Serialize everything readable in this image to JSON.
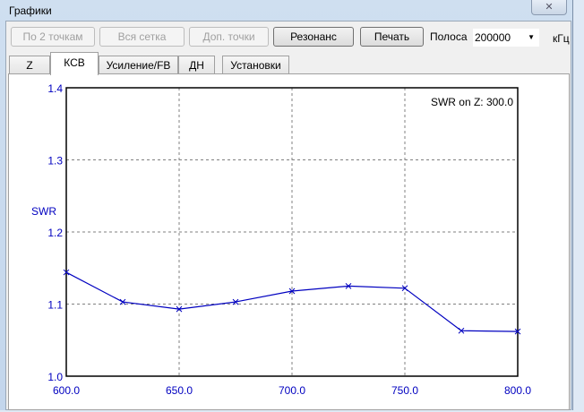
{
  "window": {
    "title": "Графики",
    "close_icon": "close-icon"
  },
  "toolbar": {
    "by_2_points": "По 2 точкам",
    "full_grid": "Вся сетка",
    "extra_points": "Доп. точки",
    "resonance": "Резонанс",
    "print": "Печать",
    "band_label": "Полоса",
    "band_value": "200000",
    "unit": "кГц"
  },
  "tabs": [
    {
      "label": "Z"
    },
    {
      "label": "КСВ"
    },
    {
      "label": "Усиление/FB"
    },
    {
      "label": "ДН"
    },
    {
      "label": "Установки"
    }
  ],
  "chart_data": {
    "type": "line",
    "title": "SWR on Z: 300.0",
    "xlabel": "",
    "ylabel": "SWR",
    "xlim": [
      600,
      800
    ],
    "ylim": [
      1.0,
      1.4
    ],
    "x_ticks": [
      "600.0",
      "650.0",
      "700.0",
      "750.0",
      "800.0"
    ],
    "y_ticks": [
      "1.0",
      "1.1",
      "1.2",
      "1.3",
      "1.4"
    ],
    "grid": true,
    "series": [
      {
        "name": "SWR",
        "color": "#0000c0",
        "x": [
          600,
          625,
          650,
          675,
          700,
          725,
          750,
          775,
          800
        ],
        "y": [
          1.144,
          1.103,
          1.093,
          1.103,
          1.118,
          1.125,
          1.122,
          1.063,
          1.062
        ]
      }
    ]
  }
}
